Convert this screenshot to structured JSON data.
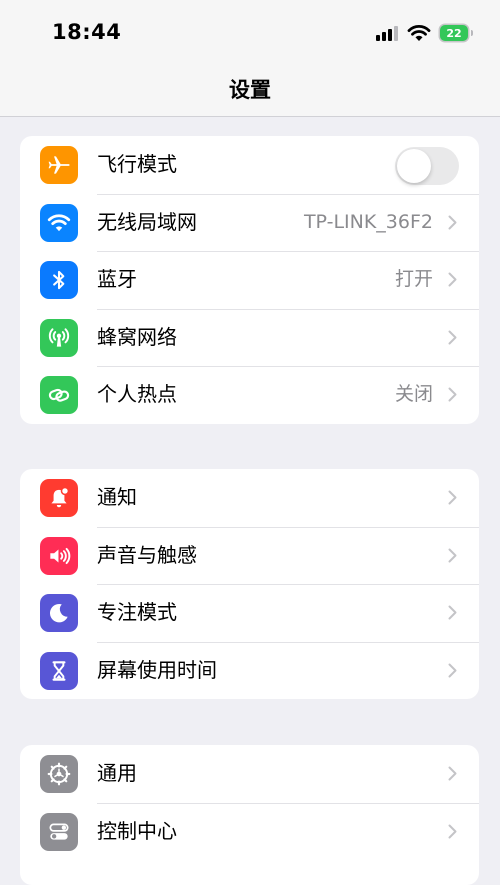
{
  "status": {
    "time": "18:44",
    "battery": "22"
  },
  "nav": {
    "title": "设置"
  },
  "colors": {
    "orange": "#fe9500",
    "blue": "#0a84ff",
    "bluetooth": "#0a7afe",
    "green": "#33c759",
    "red": "#ff3b30",
    "pink": "#ff2d55",
    "indigo": "#5856d6",
    "gray": "#8e8e93"
  },
  "group1": {
    "airplane": {
      "label": "飞行模式",
      "icon": "airplane-icon",
      "toggle_on": false
    },
    "wifi": {
      "label": "无线局域网",
      "value": "TP-LINK_36F2",
      "icon": "wifi-icon"
    },
    "bluetooth": {
      "label": "蓝牙",
      "value": "打开",
      "icon": "bluetooth-icon"
    },
    "cellular": {
      "label": "蜂窝网络",
      "icon": "cellular-antenna-icon"
    },
    "hotspot": {
      "label": "个人热点",
      "value": "关闭",
      "icon": "hotspot-chain-icon"
    }
  },
  "group2": {
    "notifications": {
      "label": "通知",
      "icon": "notification-bell-icon"
    },
    "sounds": {
      "label": "声音与触感",
      "icon": "speaker-icon"
    },
    "focus": {
      "label": "专注模式",
      "icon": "moon-icon"
    },
    "screentime": {
      "label": "屏幕使用时间",
      "icon": "hourglass-icon"
    }
  },
  "group3": {
    "general": {
      "label": "通用",
      "icon": "gear-icon"
    },
    "control_center": {
      "label": "控制中心",
      "icon": "toggles-icon"
    }
  }
}
